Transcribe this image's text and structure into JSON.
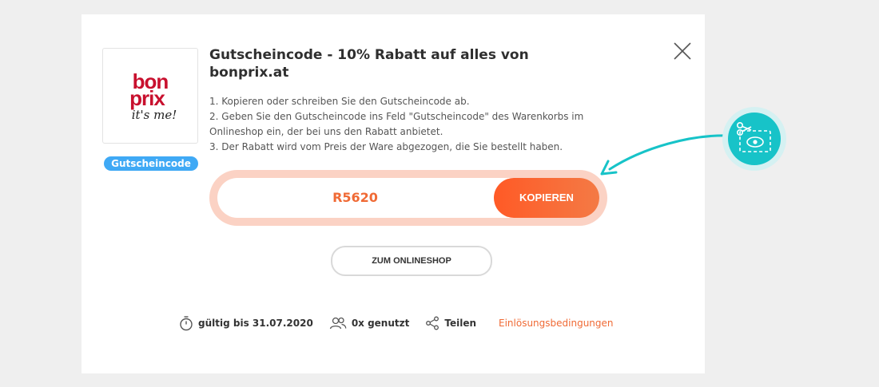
{
  "brand": {
    "logo_line1": "bon",
    "logo_line2": "prix",
    "logo_tagline": "it's me!",
    "badge_label": "Gutscheincode"
  },
  "offer": {
    "title": "Gutscheincode - 10% Rabatt auf alles von bonprix.at",
    "steps": [
      "1. Kopieren oder schreiben Sie den Gutscheincode ab.",
      "2. Geben Sie den Gutscheincode ins Feld \"Gutscheincode\" des Warenkorbs im Onlineshop ein, der bei uns den Rabatt anbietet.",
      "3. Der Rabatt wird vom Preis der Ware abgezogen, die Sie bestellt haben."
    ]
  },
  "code": {
    "value": "R5620",
    "copy_label": "KOPIEREN"
  },
  "shop_button_label": "ZUM ONLINESHOP",
  "footer": {
    "valid_until": "gültig bis 31.07.2020",
    "used_count": "0x genutzt",
    "share_label": "Teilen",
    "terms_label": "Einlösungsbedingungen"
  },
  "colors": {
    "accent": "#f06a35",
    "badge": "#3fa9f5",
    "teal": "#17c3c8",
    "brand_red": "#c8102e"
  }
}
